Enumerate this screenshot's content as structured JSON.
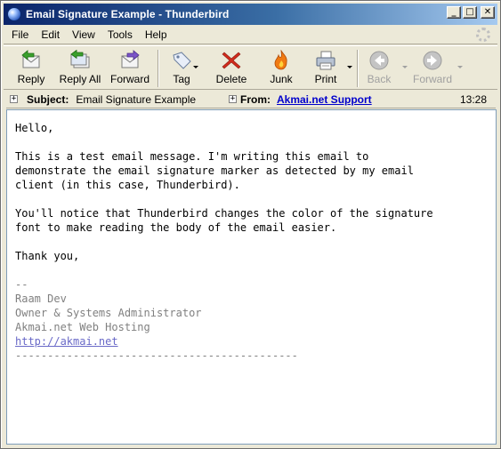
{
  "window": {
    "title": "Email Signature Example - Thunderbird",
    "controls": {
      "minimize": "_",
      "maximize": "□",
      "close": "✕"
    }
  },
  "menu": [
    "File",
    "Edit",
    "View",
    "Tools",
    "Help"
  ],
  "toolbar": {
    "reply": "Reply",
    "reply_all": "Reply All",
    "forward": "Forward",
    "tag": "Tag",
    "delete": "Delete",
    "junk": "Junk",
    "print": "Print",
    "back": "Back",
    "forward_nav": "Forward"
  },
  "header": {
    "subject_label": "Subject:",
    "subject_value": "Email Signature Example",
    "from_label": "From:",
    "from_value": "Akmai.net Support",
    "time": "13:28"
  },
  "message": {
    "greeting": "Hello,",
    "para1": "This is a test email message. I'm writing this email to\ndemonstrate the email signature marker as detected by my email\nclient (in this case, Thunderbird).",
    "para2": "You'll notice that Thunderbird changes the color of the signature\nfont to make reading the body of the email easier.",
    "closing": "Thank you,",
    "signature": {
      "marker": "--",
      "name": "Raam Dev",
      "role": "Owner & Systems Administrator",
      "company": "Akmai.net Web Hosting",
      "url": "http://akmai.net",
      "rule": "--------------------------------------------"
    }
  },
  "colors": {
    "titlebar_start": "#0a246a",
    "link": "#0000cc",
    "signature": "#808080"
  }
}
